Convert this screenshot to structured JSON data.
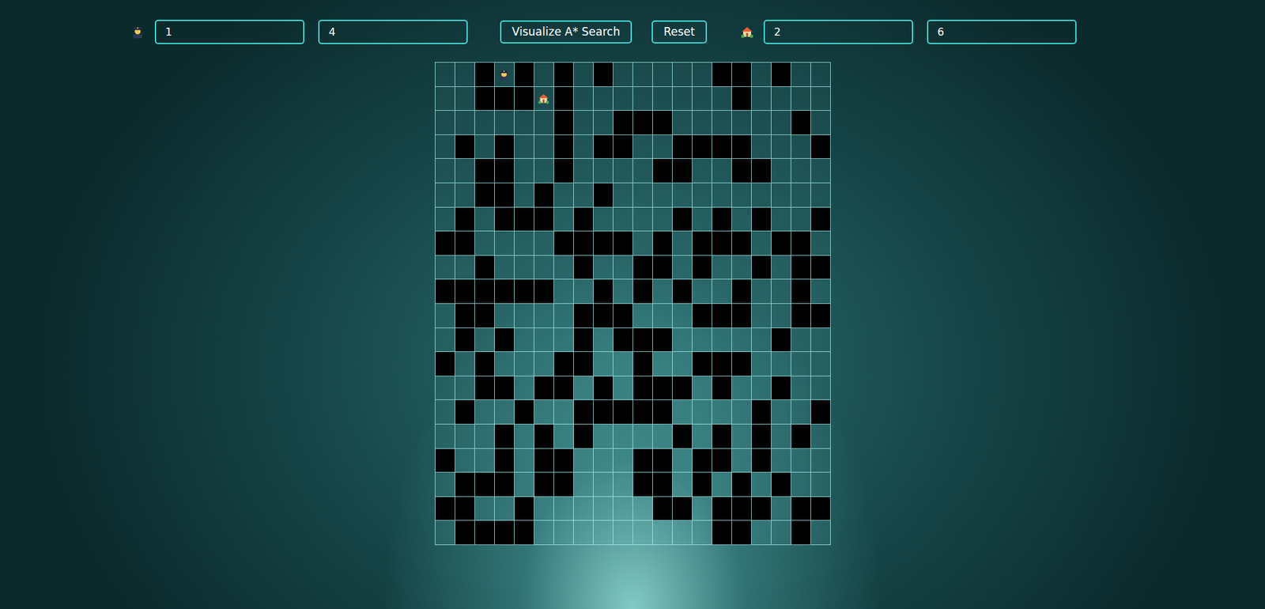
{
  "start": {
    "row": "1",
    "col": "4"
  },
  "goal": {
    "row": "2",
    "col": "6"
  },
  "buttons": [
    "Visualize A* Search",
    "Reset"
  ],
  "grid": {
    "rows": [
      [
        "open",
        "open",
        "wall",
        "start",
        "wall",
        "open",
        "wall",
        "open",
        "wall",
        "open",
        "open",
        "open",
        "open",
        "open",
        "wall",
        "wall",
        "open",
        "wall",
        "open",
        "open"
      ],
      [
        "open",
        "open",
        "wall",
        "wall",
        "wall",
        "goal",
        "wall",
        "open",
        "open",
        "open",
        "open",
        "open",
        "open",
        "open",
        "open",
        "wall",
        "open",
        "open",
        "open",
        "open"
      ],
      [
        "open",
        "open",
        "open",
        "open",
        "open",
        "open",
        "wall",
        "open",
        "open",
        "wall",
        "wall",
        "wall",
        "open",
        "open",
        "open",
        "open",
        "open",
        "open",
        "wall",
        "open"
      ],
      [
        "open",
        "wall",
        "open",
        "wall",
        "open",
        "open",
        "wall",
        "open",
        "wall",
        "wall",
        "open",
        "open",
        "wall",
        "wall",
        "wall",
        "wall",
        "open",
        "open",
        "open",
        "wall"
      ],
      [
        "open",
        "open",
        "wall",
        "wall",
        "open",
        "open",
        "wall",
        "open",
        "open",
        "open",
        "open",
        "wall",
        "wall",
        "open",
        "open",
        "wall",
        "wall",
        "open",
        "open",
        "open"
      ],
      [
        "open",
        "open",
        "wall",
        "wall",
        "open",
        "wall",
        "open",
        "open",
        "wall",
        "open",
        "open",
        "open",
        "open",
        "open",
        "open",
        "open",
        "open",
        "open",
        "open",
        "open"
      ],
      [
        "open",
        "wall",
        "open",
        "wall",
        "wall",
        "wall",
        "open",
        "wall",
        "open",
        "open",
        "open",
        "open",
        "wall",
        "open",
        "wall",
        "open",
        "wall",
        "open",
        "open",
        "wall"
      ],
      [
        "wall",
        "wall",
        "open",
        "open",
        "open",
        "open",
        "wall",
        "wall",
        "wall",
        "wall",
        "open",
        "wall",
        "open",
        "wall",
        "wall",
        "wall",
        "open",
        "wall",
        "wall",
        "open"
      ],
      [
        "open",
        "open",
        "wall",
        "open",
        "open",
        "open",
        "open",
        "wall",
        "open",
        "open",
        "wall",
        "wall",
        "open",
        "wall",
        "open",
        "open",
        "wall",
        "open",
        "wall",
        "wall"
      ],
      [
        "wall",
        "wall",
        "wall",
        "wall",
        "wall",
        "wall",
        "open",
        "open",
        "wall",
        "open",
        "wall",
        "open",
        "wall",
        "open",
        "open",
        "wall",
        "open",
        "open",
        "wall",
        "open"
      ],
      [
        "open",
        "wall",
        "wall",
        "open",
        "open",
        "open",
        "open",
        "wall",
        "wall",
        "wall",
        "open",
        "open",
        "open",
        "wall",
        "wall",
        "wall",
        "open",
        "open",
        "wall",
        "wall"
      ],
      [
        "open",
        "wall",
        "open",
        "wall",
        "open",
        "open",
        "open",
        "wall",
        "open",
        "wall",
        "wall",
        "wall",
        "open",
        "open",
        "open",
        "open",
        "open",
        "wall",
        "open",
        "open"
      ],
      [
        "wall",
        "open",
        "wall",
        "open",
        "open",
        "open",
        "wall",
        "wall",
        "open",
        "open",
        "wall",
        "open",
        "open",
        "wall",
        "wall",
        "wall",
        "open",
        "open",
        "open",
        "open"
      ],
      [
        "open",
        "open",
        "wall",
        "wall",
        "open",
        "wall",
        "wall",
        "open",
        "wall",
        "open",
        "wall",
        "wall",
        "wall",
        "open",
        "wall",
        "open",
        "open",
        "wall",
        "open",
        "open"
      ],
      [
        "open",
        "wall",
        "open",
        "open",
        "wall",
        "open",
        "open",
        "wall",
        "wall",
        "wall",
        "wall",
        "wall",
        "open",
        "open",
        "open",
        "open",
        "wall",
        "open",
        "open",
        "wall"
      ],
      [
        "open",
        "open",
        "open",
        "wall",
        "open",
        "wall",
        "open",
        "wall",
        "open",
        "open",
        "open",
        "open",
        "wall",
        "open",
        "wall",
        "open",
        "wall",
        "open",
        "wall",
        "open"
      ],
      [
        "wall",
        "open",
        "open",
        "wall",
        "open",
        "wall",
        "wall",
        "open",
        "open",
        "open",
        "wall",
        "wall",
        "open",
        "wall",
        "wall",
        "open",
        "wall",
        "open",
        "open",
        "open"
      ],
      [
        "open",
        "wall",
        "wall",
        "wall",
        "open",
        "wall",
        "wall",
        "open",
        "open",
        "open",
        "wall",
        "wall",
        "open",
        "wall",
        "open",
        "wall",
        "open",
        "wall",
        "open",
        "open"
      ],
      [
        "wall",
        "wall",
        "open",
        "open",
        "wall",
        "open",
        "open",
        "open",
        "open",
        "open",
        "open",
        "wall",
        "wall",
        "open",
        "wall",
        "wall",
        "wall",
        "open",
        "wall",
        "wall"
      ],
      [
        "open",
        "wall",
        "wall",
        "wall",
        "wall",
        "open",
        "open",
        "open",
        "open",
        "open",
        "open",
        "open",
        "open",
        "open",
        "wall",
        "wall",
        "open",
        "open",
        "wall",
        "open"
      ]
    ]
  }
}
